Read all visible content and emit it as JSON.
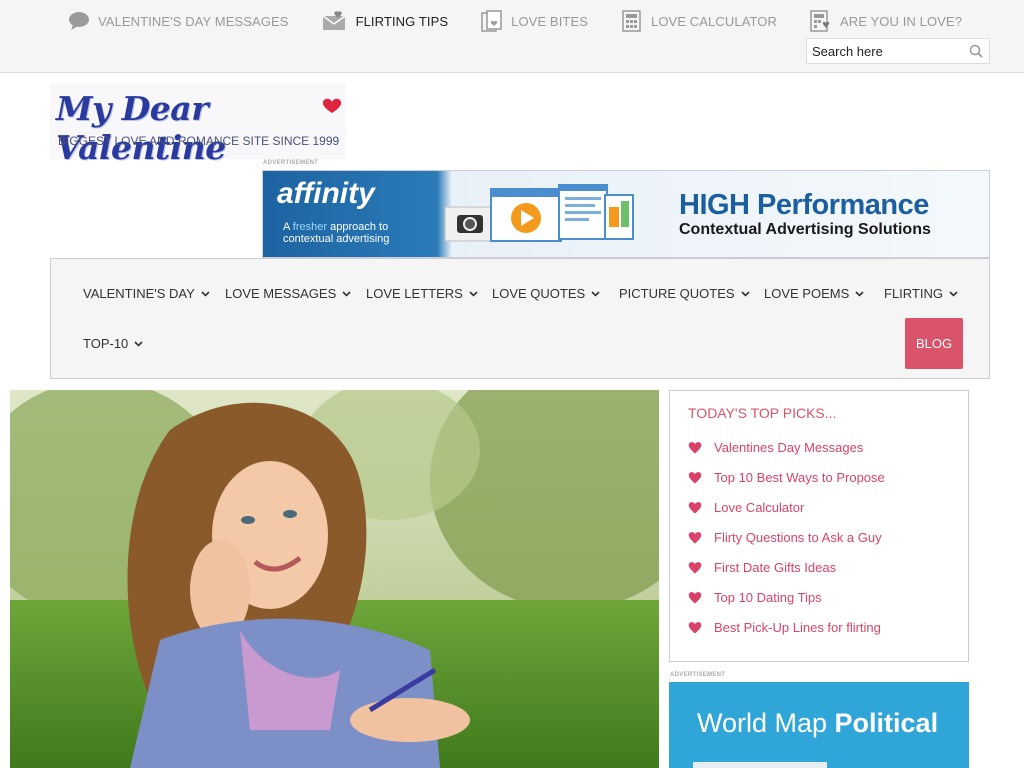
{
  "topnav": {
    "items": [
      {
        "label": "VALENTINE'S DAY MESSAGES",
        "icon": "chat-bubble-icon",
        "active": false
      },
      {
        "label": "FLIRTING TIPS",
        "icon": "love-letter-icon",
        "active": true
      },
      {
        "label": "LOVE BITES",
        "icon": "documents-icon",
        "active": false
      },
      {
        "label": "LOVE CALCULATOR",
        "icon": "calculator-icon",
        "active": false
      },
      {
        "label": "ARE YOU IN LOVE?",
        "icon": "calculator-heart-icon",
        "active": false
      }
    ],
    "search_placeholder": "Search here"
  },
  "logo": {
    "title": "My Dear Valentine",
    "tagline": "BIGGEST LOVE AND ROMANCE SITE SINCE 1999"
  },
  "ads": {
    "label": "ADVERTISEMENT",
    "banner": {
      "brand": "affinity",
      "sub_line1_pre": "A ",
      "sub_fresh": "fresher",
      "sub_line1_post": " approach to",
      "sub_line2": "contextual advertising",
      "headline": "HIGH Performance",
      "tagline": "Contextual Advertising Solutions"
    },
    "side": {
      "text_regular": "World Map ",
      "text_bold": "Political"
    }
  },
  "mainnav": {
    "items": [
      {
        "label": "VALENTINE'S DAY"
      },
      {
        "label": "LOVE MESSAGES"
      },
      {
        "label": "LOVE LETTERS"
      },
      {
        "label": "LOVE QUOTES"
      },
      {
        "label": "PICTURE QUOTES"
      },
      {
        "label": "LOVE POEMS"
      },
      {
        "label": "FLIRTING"
      },
      {
        "label": "TOP-10"
      }
    ],
    "blog_label": "BLOG"
  },
  "picks": {
    "title": "TODAY'S TOP PICKS...",
    "items": [
      "Valentines Day Messages",
      "Top 10 Best Ways to Propose",
      "Love Calculator",
      "Flirty Questions to Ask a Guy",
      "First Date Gifts Ideas",
      "Top 10 Dating Tips",
      "Best Pick-Up Lines for flirting"
    ]
  },
  "colors": {
    "accent": "#d9536a",
    "link": "#d9436a",
    "logo_blue": "#2a3a9e"
  }
}
